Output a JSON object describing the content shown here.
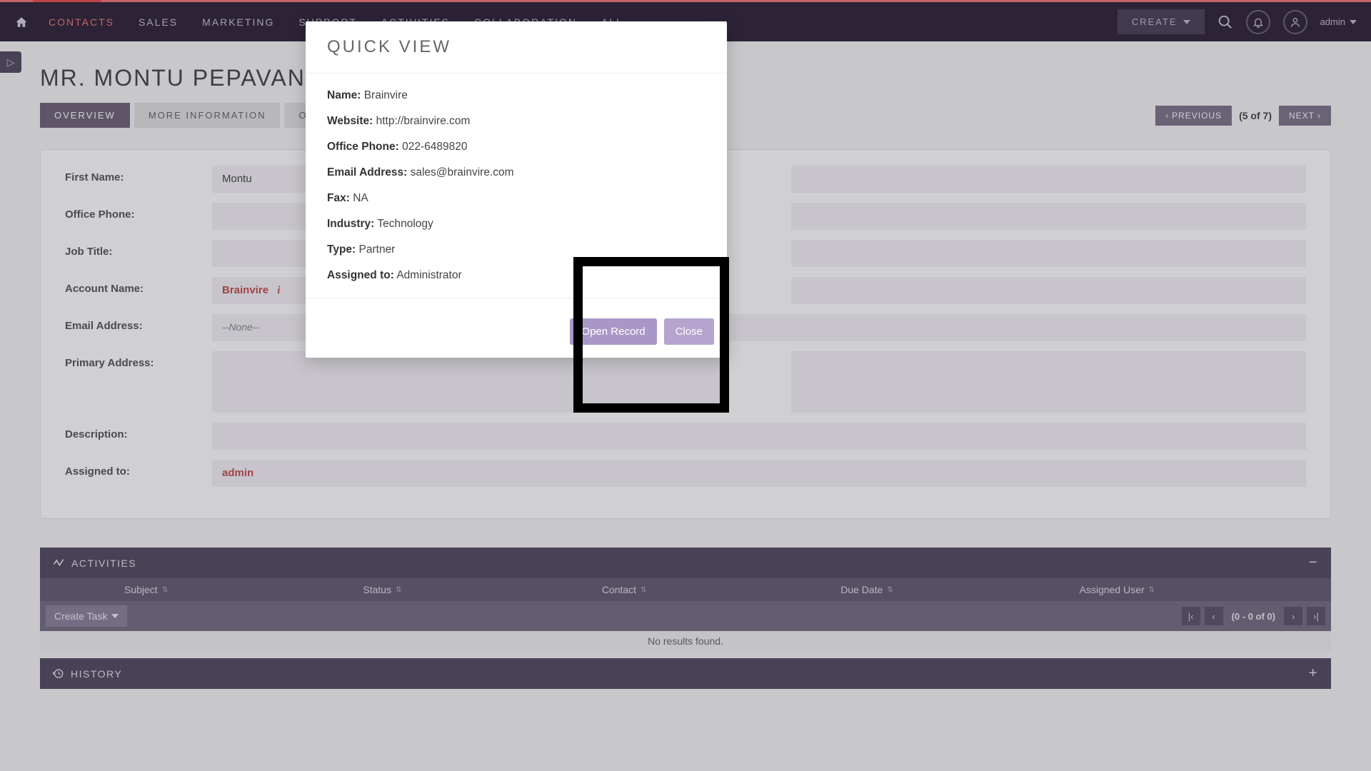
{
  "nav": {
    "items": [
      "CONTACTS",
      "SALES",
      "MARKETING",
      "SUPPORT",
      "ACTIVITIES",
      "COLLABORATION",
      "ALL"
    ],
    "create": "CREATE",
    "user": "admin"
  },
  "page": {
    "title": "MR. MONTU PEPAVANSHI",
    "tabs": [
      "OVERVIEW",
      "MORE INFORMATION",
      "OTHER"
    ],
    "prev": "PREVIOUS",
    "next": "NEXT",
    "position": "(5 of 7)"
  },
  "fields": {
    "first_name_label": "First Name:",
    "first_name_value": "Montu",
    "office_phone_label": "Office Phone:",
    "office_phone_value": "",
    "job_title_label": "Job Title:",
    "job_title_value": "",
    "account_name_label": "Account Name:",
    "account_name_value": "Brainvire",
    "email_label": "Email Address:",
    "email_value": "--None--",
    "primary_address_label": "Primary Address:",
    "primary_address_value": "",
    "description_label": "Description:",
    "description_value": "",
    "assigned_to_label": "Assigned to:",
    "assigned_to_value": "admin"
  },
  "activities": {
    "title": "ACTIVITIES",
    "columns": [
      "Subject",
      "Status",
      "Contact",
      "Due Date",
      "Assigned User"
    ],
    "create_task": "Create Task",
    "range": "(0 - 0 of 0)",
    "no_results": "No results found."
  },
  "history": {
    "title": "HISTORY"
  },
  "modal": {
    "title": "QUICK VIEW",
    "rows": {
      "name_label": "Name:",
      "name_value": "Brainvire",
      "website_label": "Website:",
      "website_value": "http://brainvire.com",
      "office_phone_label": "Office Phone:",
      "office_phone_value": "022-6489820",
      "email_label": "Email Address:",
      "email_value": "sales@brainvire.com",
      "fax_label": "Fax:",
      "fax_value": "NA",
      "industry_label": "Industry:",
      "industry_value": "Technology",
      "type_label": "Type:",
      "type_value": "Partner",
      "assigned_label": "Assigned to:",
      "assigned_value": "Administrator"
    },
    "open": "Open Record",
    "close": "Close"
  }
}
